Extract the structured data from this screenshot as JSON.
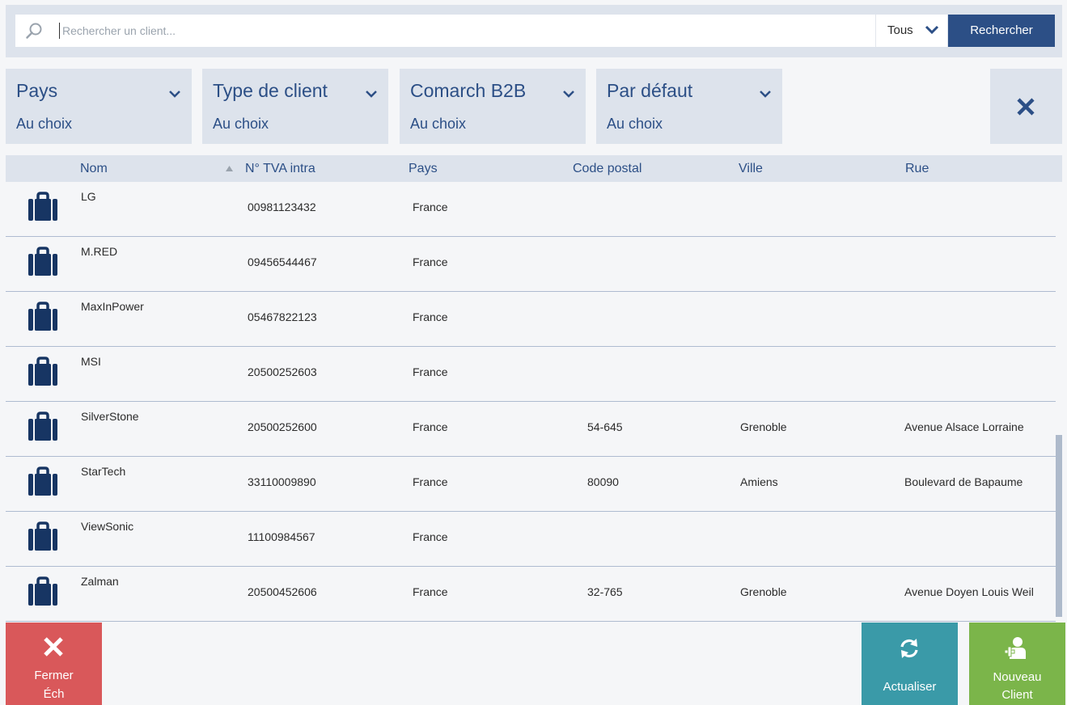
{
  "search": {
    "placeholder": "Rechercher un client...",
    "scope_value": "Tous",
    "search_button": "Rechercher"
  },
  "filters": [
    {
      "title": "Pays",
      "value": "Au choix"
    },
    {
      "title": "Type de client",
      "value": "Au choix"
    },
    {
      "title": "Comarch B2B",
      "value": "Au choix"
    },
    {
      "title": "Par défaut",
      "value": "Au choix"
    }
  ],
  "table": {
    "columns": [
      "Nom",
      "N° TVA intra",
      "Pays",
      "Code postal",
      "Ville",
      "Rue"
    ],
    "sorted_column": "N° TVA intra",
    "rows": [
      {
        "name": "LG",
        "vat": "00981123432",
        "country": "France",
        "postal": "",
        "city": "",
        "street": ""
      },
      {
        "name": "M.RED",
        "vat": "09456544467",
        "country": "France",
        "postal": "",
        "city": "",
        "street": ""
      },
      {
        "name": "MaxInPower",
        "vat": "05467822123",
        "country": "France",
        "postal": "",
        "city": "",
        "street": ""
      },
      {
        "name": "MSI",
        "vat": "20500252603",
        "country": "France",
        "postal": "",
        "city": "",
        "street": ""
      },
      {
        "name": "SilverStone",
        "vat": "20500252600",
        "country": "France",
        "postal": "54-645",
        "city": "Grenoble",
        "street": "Avenue Alsace Lorraine"
      },
      {
        "name": "StarTech",
        "vat": "33110009890",
        "country": "France",
        "postal": "80090",
        "city": "Amiens",
        "street": "Boulevard de Bapaume"
      },
      {
        "name": "ViewSonic",
        "vat": "11100984567",
        "country": "France",
        "postal": "",
        "city": "",
        "street": ""
      },
      {
        "name": "Zalman",
        "vat": "20500452606",
        "country": "France",
        "postal": "32-765",
        "city": "Grenoble",
        "street": "Avenue Doyen Louis Weil"
      }
    ]
  },
  "actions": {
    "close": {
      "line1": "Fermer",
      "line2": "Éch"
    },
    "refresh": {
      "label": "Actualiser"
    },
    "new_client": {
      "line1": "Nouveau",
      "line2": "Client"
    }
  },
  "colors": {
    "accent": "#2c4f86",
    "panel": "#dde3ec",
    "close_button": "#d9585a",
    "refresh_button": "#3a9aa8",
    "new_client_button": "#7bb54a"
  },
  "icons": {
    "search": "search-icon",
    "scope_dropdown": "chevron-down-icon",
    "clear_filters": "close-icon",
    "client_row": "briefcase-icon",
    "close": "close-icon",
    "refresh": "refresh-icon",
    "new_client": "add-user-icon"
  }
}
